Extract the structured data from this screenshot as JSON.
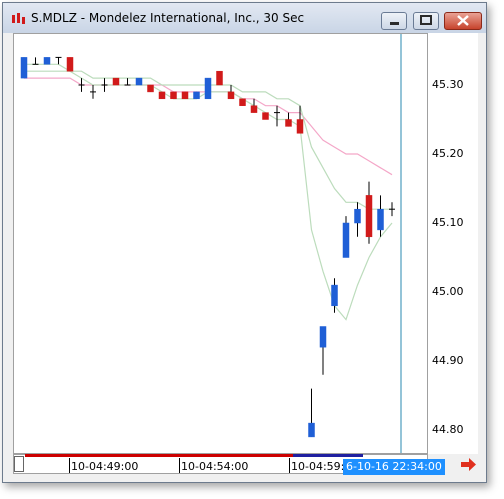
{
  "window": {
    "title": "S.MDLZ - Mondelez International, Inc., 30 Sec"
  },
  "colors": {
    "up_candle": "#1f5fd6",
    "down_candle": "#d11a1a",
    "ma_fast": "#bcdcbc",
    "ma_slow": "#f4a7c8",
    "cursor_line": "#2a8ab0",
    "cursor_label_bg": "#1e90ff"
  },
  "price_axis": {
    "labels": [
      "45.30",
      "45.20",
      "45.10",
      "45.00",
      "44.90",
      "44.80"
    ]
  },
  "time_axis": {
    "labels": [
      "10-04:49:00",
      "10-04:54:00",
      "10-04:59:00"
    ],
    "cursor_label": "6-10-16 22:34:00"
  },
  "chart_data": {
    "type": "candlestick",
    "symbol": "S.MDLZ",
    "interval": "30 Sec",
    "y_range": [
      44.78,
      45.34
    ],
    "candles": [
      {
        "o": 45.31,
        "h": 45.34,
        "l": 45.31,
        "c": 45.34
      },
      {
        "o": 45.33,
        "h": 45.34,
        "l": 45.33,
        "c": 45.33
      },
      {
        "o": 45.33,
        "h": 45.34,
        "l": 45.33,
        "c": 45.34
      },
      {
        "o": 45.34,
        "h": 45.34,
        "l": 45.33,
        "c": 45.34
      },
      {
        "o": 45.34,
        "h": 45.34,
        "l": 45.32,
        "c": 45.32
      },
      {
        "o": 45.3,
        "h": 45.31,
        "l": 45.29,
        "c": 45.3
      },
      {
        "o": 45.29,
        "h": 45.3,
        "l": 45.28,
        "c": 45.29
      },
      {
        "o": 45.3,
        "h": 45.31,
        "l": 45.29,
        "c": 45.3
      },
      {
        "o": 45.31,
        "h": 45.31,
        "l": 45.3,
        "c": 45.3
      },
      {
        "o": 45.3,
        "h": 45.31,
        "l": 45.3,
        "c": 45.3
      },
      {
        "o": 45.3,
        "h": 45.31,
        "l": 45.3,
        "c": 45.31
      },
      {
        "o": 45.3,
        "h": 45.3,
        "l": 45.29,
        "c": 45.29
      },
      {
        "o": 45.29,
        "h": 45.29,
        "l": 45.28,
        "c": 45.28
      },
      {
        "o": 45.29,
        "h": 45.29,
        "l": 45.28,
        "c": 45.28
      },
      {
        "o": 45.29,
        "h": 45.29,
        "l": 45.28,
        "c": 45.28
      },
      {
        "o": 45.28,
        "h": 45.29,
        "l": 45.28,
        "c": 45.29
      },
      {
        "o": 45.28,
        "h": 45.31,
        "l": 45.28,
        "c": 45.31
      },
      {
        "o": 45.32,
        "h": 45.32,
        "l": 45.3,
        "c": 45.3
      },
      {
        "o": 45.29,
        "h": 45.3,
        "l": 45.28,
        "c": 45.28
      },
      {
        "o": 45.28,
        "h": 45.28,
        "l": 45.27,
        "c": 45.27
      },
      {
        "o": 45.27,
        "h": 45.28,
        "l": 45.26,
        "c": 45.26
      },
      {
        "o": 45.26,
        "h": 45.26,
        "l": 45.25,
        "c": 45.25
      },
      {
        "o": 45.26,
        "h": 45.27,
        "l": 45.24,
        "c": 45.26
      },
      {
        "o": 45.25,
        "h": 45.26,
        "l": 45.24,
        "c": 45.24
      },
      {
        "o": 45.25,
        "h": 45.27,
        "l": 45.23,
        "c": 45.23
      },
      {
        "o": 44.79,
        "h": 44.86,
        "l": 44.79,
        "c": 44.81
      },
      {
        "o": 44.92,
        "h": 44.95,
        "l": 44.88,
        "c": 44.95
      },
      {
        "o": 44.98,
        "h": 45.02,
        "l": 44.97,
        "c": 45.01
      },
      {
        "o": 45.05,
        "h": 45.11,
        "l": 45.05,
        "c": 45.1
      },
      {
        "o": 45.1,
        "h": 45.13,
        "l": 45.08,
        "c": 45.12
      },
      {
        "o": 45.14,
        "h": 45.16,
        "l": 45.07,
        "c": 45.08
      },
      {
        "o": 45.09,
        "h": 45.14,
        "l": 45.08,
        "c": 45.12
      },
      {
        "o": 45.12,
        "h": 45.13,
        "l": 45.11,
        "c": 45.12
      }
    ],
    "ma_fast": [
      45.32,
      45.32,
      45.32,
      45.32,
      45.32,
      45.31,
      45.3,
      45.3,
      45.3,
      45.3,
      45.3,
      45.3,
      45.29,
      45.28,
      45.28,
      45.28,
      45.29,
      45.29,
      45.29,
      45.28,
      45.27,
      45.26,
      45.25,
      45.25,
      45.24,
      45.09,
      45.03,
      44.98,
      44.96,
      45.01,
      45.05,
      45.08,
      45.1
    ],
    "ma_slow": [
      45.33,
      45.33,
      45.33,
      45.33,
      45.32,
      45.32,
      45.31,
      45.31,
      45.31,
      45.31,
      45.31,
      45.31,
      45.3,
      45.3,
      45.3,
      45.3,
      45.3,
      45.3,
      45.3,
      45.29,
      45.29,
      45.29,
      45.28,
      45.28,
      45.27,
      45.21,
      45.18,
      45.15,
      45.13,
      45.13,
      45.12,
      45.12,
      45.12
    ],
    "ma_slow2": [
      45.31,
      45.31,
      45.31,
      45.31,
      45.31,
      45.3,
      45.3,
      45.3,
      45.3,
      45.3,
      45.3,
      45.3,
      45.3,
      45.29,
      45.29,
      45.29,
      45.29,
      45.29,
      45.29,
      45.28,
      45.28,
      45.27,
      45.27,
      45.26,
      45.26,
      45.24,
      45.22,
      45.21,
      45.2,
      45.2,
      45.19,
      45.18,
      45.17
    ]
  }
}
